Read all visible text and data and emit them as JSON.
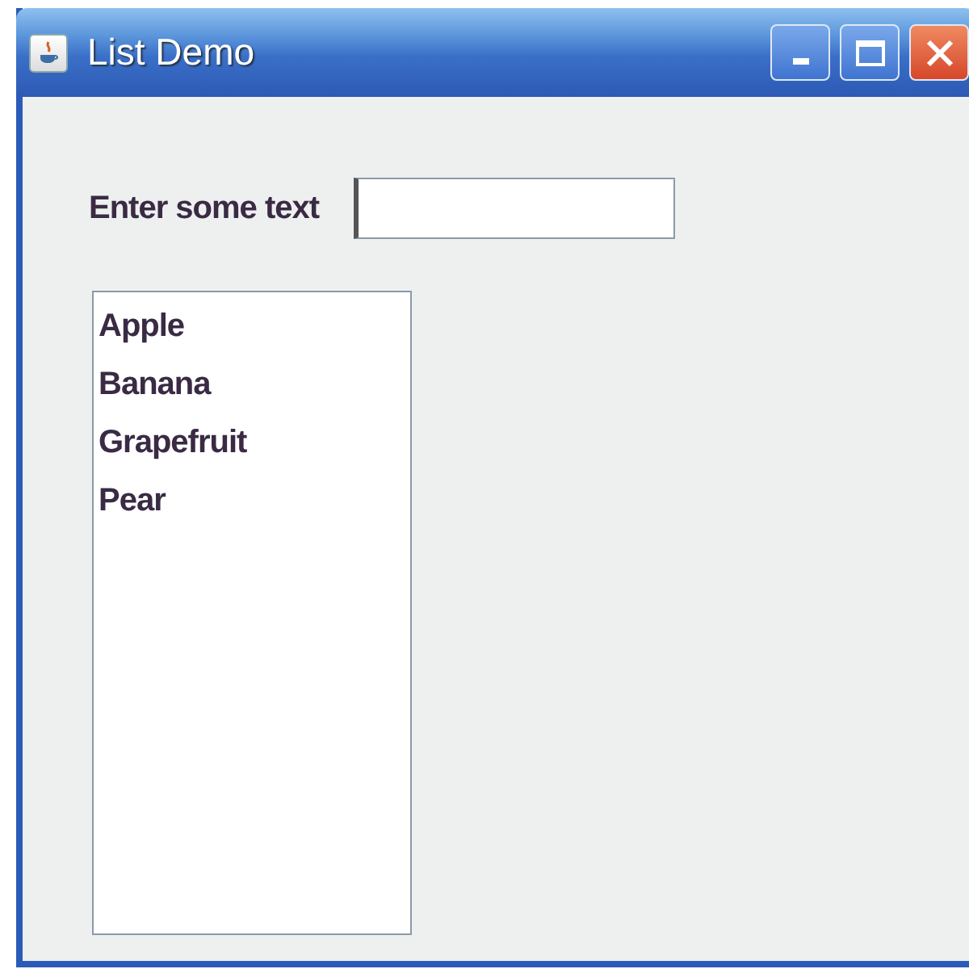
{
  "window": {
    "title": "List Demo"
  },
  "form": {
    "label": "Enter some text"
  },
  "list": {
    "items": [
      {
        "label": "Apple",
        "selected": false
      },
      {
        "label": "Banana",
        "selected": false
      },
      {
        "label": "Grapefruit",
        "selected": false
      },
      {
        "label": "Pear",
        "selected": false
      }
    ]
  }
}
